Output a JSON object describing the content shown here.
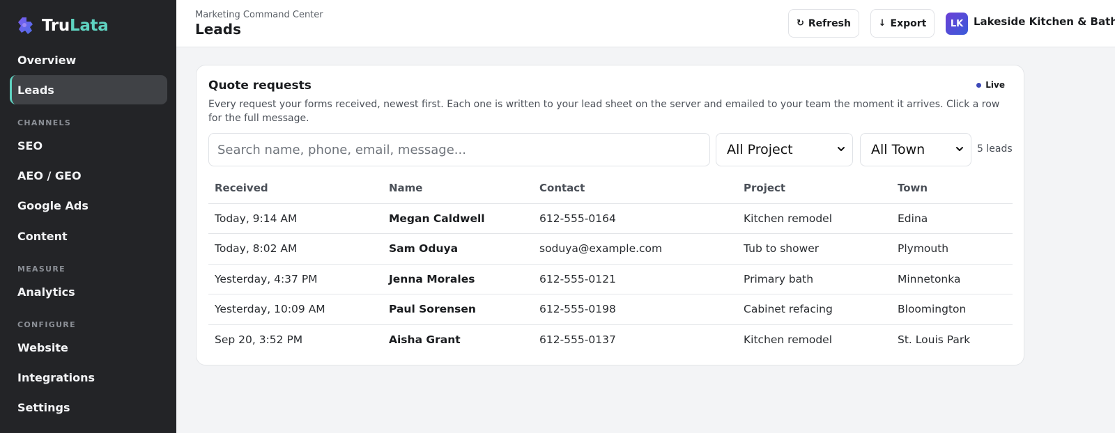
{
  "brand": {
    "part1": "Tru",
    "part2": "Lata"
  },
  "sidebar": {
    "items": [
      {
        "label": "Overview"
      },
      {
        "label": "Leads"
      },
      {
        "label": "SEO"
      },
      {
        "label": "AEO / GEO"
      },
      {
        "label": "Google Ads"
      },
      {
        "label": "Content"
      },
      {
        "label": "Analytics"
      },
      {
        "label": "Website"
      },
      {
        "label": "Integrations"
      },
      {
        "label": "Settings"
      }
    ],
    "sections": {
      "channels": "CHANNELS",
      "measure": "MEASURE",
      "configure": "CONFIGURE"
    },
    "active": "Leads"
  },
  "header": {
    "breadcrumb": "Marketing Command Center",
    "title": "Leads",
    "refresh_label": "Refresh",
    "export_label": "Export",
    "avatar_initials": "LK",
    "account_name": "Lakeside Kitchen & Bath"
  },
  "card": {
    "title": "Quote requests",
    "live_label": "Live",
    "description": "Every request your forms received, newest first. Each one is written to your lead sheet on the server and emailed to your team the moment it arrives. Click a row for the full message.",
    "search_placeholder": "Search name, phone, email, message...",
    "project_filter": "All Project",
    "town_filter": "All Town",
    "count_label": "5 leads"
  },
  "table": {
    "columns": [
      "Received",
      "Name",
      "Contact",
      "Project",
      "Town"
    ],
    "rows": [
      {
        "received": "Today, 9:14 AM",
        "name": "Megan Caldwell",
        "contact": "612-555-0164",
        "project": "Kitchen remodel",
        "town": "Edina"
      },
      {
        "received": "Today, 8:02 AM",
        "name": "Sam Oduya",
        "contact": "soduya@example.com",
        "project": "Tub to shower",
        "town": "Plymouth"
      },
      {
        "received": "Yesterday, 4:37 PM",
        "name": "Jenna Morales",
        "contact": "612-555-0121",
        "project": "Primary bath",
        "town": "Minnetonka"
      },
      {
        "received": "Yesterday, 10:09 AM",
        "name": "Paul Sorensen",
        "contact": "612-555-0198",
        "project": "Cabinet refacing",
        "town": "Bloomington"
      },
      {
        "received": "Sep 20, 3:52 PM",
        "name": "Aisha Grant",
        "contact": "612-555-0137",
        "project": "Kitchen remodel",
        "town": "St. Louis Park"
      }
    ]
  },
  "colors": {
    "sidebar_bg": "#232427",
    "accent": "#5fd3c1",
    "live_dot": "#3d49b8"
  }
}
